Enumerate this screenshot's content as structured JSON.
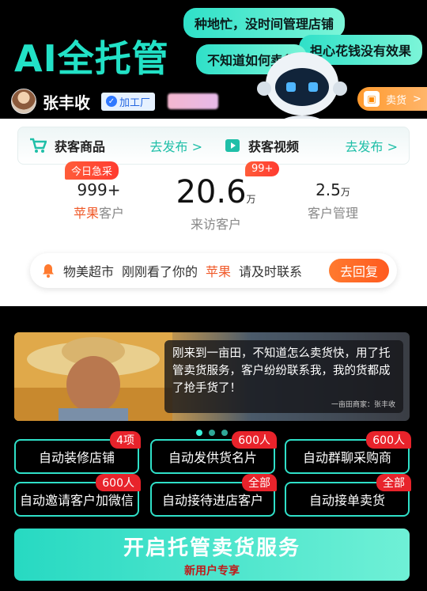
{
  "header": {
    "title": "AI全托管",
    "bubbles": [
      "种地忙，没时间管理店铺",
      "不知道如何卖货",
      "担心花钱没有效果"
    ]
  },
  "profile": {
    "name": "张丰收",
    "tag": "加工厂",
    "sell_label": "卖货",
    "sell_arrow": ">"
  },
  "tabs": [
    {
      "label": "获客商品",
      "action": "去发布 >"
    },
    {
      "label": "获客视频",
      "action": "去发布 >"
    }
  ],
  "stats": [
    {
      "value": "999+",
      "unit": "",
      "label_prefix": "苹果",
      "label": "客户",
      "badge": "今日急采"
    },
    {
      "value": "20.6",
      "unit": "万",
      "label_prefix": "",
      "label": "来访客户",
      "badge": "99+"
    },
    {
      "value": "2.5",
      "unit": "万",
      "label_prefix": "",
      "label": "客户管理",
      "badge": ""
    }
  ],
  "notice": {
    "store": "物美超市",
    "text1": "刚刚看了你的",
    "product": "苹果",
    "text2": "请及时联系",
    "button": "去回复"
  },
  "testimonial": {
    "quote": "刚来到一亩田，不知道怎么卖货快，用了托管卖货服务，客户纷纷联系我，我的货都成了抢手货了！",
    "source": "一亩田商家：张丰收"
  },
  "features": [
    {
      "label": "自动装修店铺",
      "badge": "4项"
    },
    {
      "label": "自动发供货名片",
      "badge": "600人"
    },
    {
      "label": "自动群聊采购商",
      "badge": "600人"
    },
    {
      "label": "自动邀请客户加微信",
      "badge": "600人"
    },
    {
      "label": "自动接待进店客户",
      "badge": "全部"
    },
    {
      "label": "自动接单卖货",
      "badge": "全部"
    }
  ],
  "cta": {
    "title": "开启托管卖货服务",
    "subtitle": "新用户专享"
  },
  "colors": {
    "accent": "#22e1c6",
    "orange": "#ff6a25",
    "red": "#e8232b"
  }
}
